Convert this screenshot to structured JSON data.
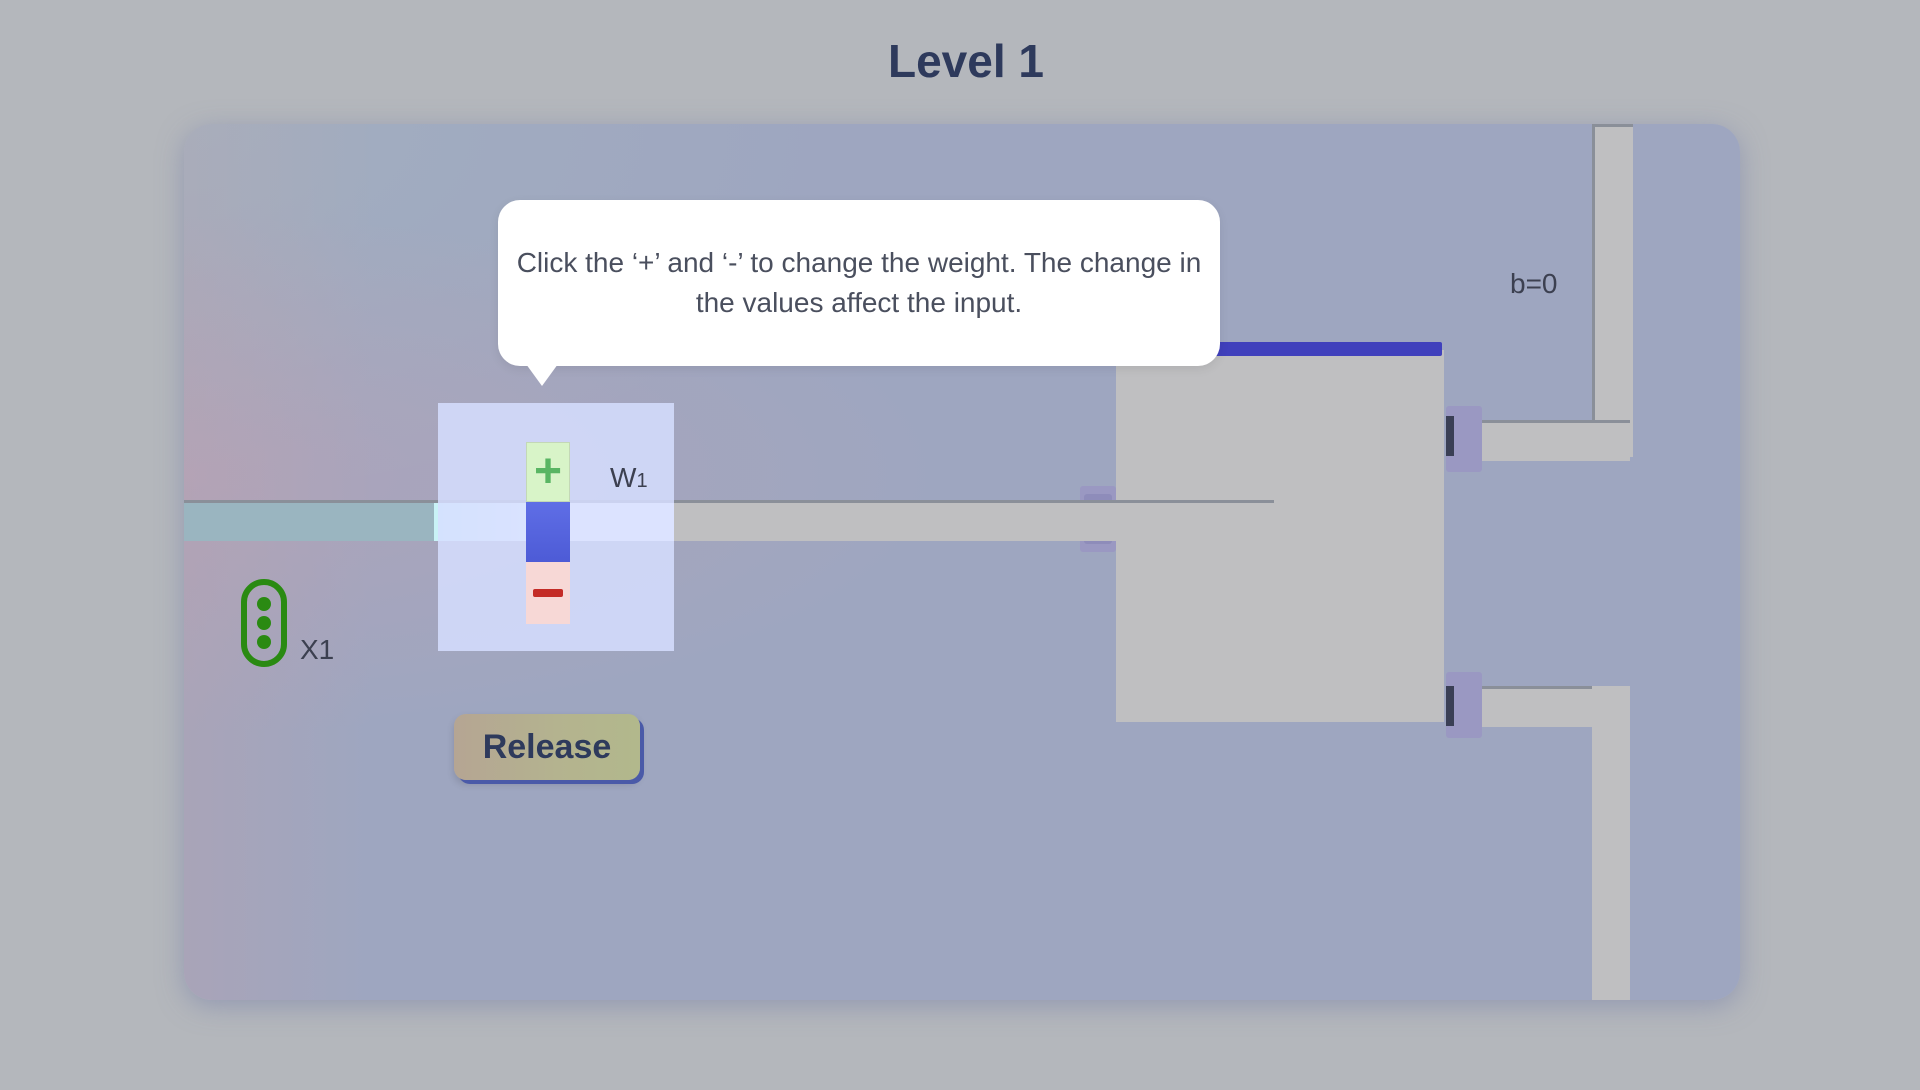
{
  "page": {
    "title": "Level 1"
  },
  "tooltip": {
    "text": "Click the ‘+’ and ‘-’ to change the weight. The change in the values affect the input."
  },
  "neuron": {
    "bias_label": "b=0"
  },
  "weight_control": {
    "label_main": "W",
    "label_sub": "1",
    "plus_symbol": "+",
    "plus_icon": "plus-icon",
    "minus_icon": "minus-icon"
  },
  "input": {
    "label": "X1",
    "icon": "input-node-icon",
    "icon_color": "#2a8a12"
  },
  "actions": {
    "release_label": "Release"
  },
  "colors": {
    "title": "#2e3a5c",
    "neuron_top_bar": "#4040bc",
    "weight_bar": "#5563dd",
    "plus": "#59b563",
    "minus": "#c42b26"
  }
}
